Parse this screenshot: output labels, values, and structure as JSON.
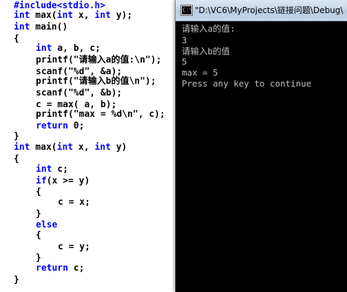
{
  "editor": {
    "lines": [
      {
        "parts": [
          {
            "t": "#include<stdio.h>",
            "k": "pre"
          }
        ]
      },
      {
        "parts": [
          {
            "t": "int",
            "k": "kw"
          },
          {
            "t": " max(",
            "k": "plain"
          },
          {
            "t": "int",
            "k": "kw"
          },
          {
            "t": " x, ",
            "k": "plain"
          },
          {
            "t": "int",
            "k": "kw"
          },
          {
            "t": " y);",
            "k": "plain"
          }
        ]
      },
      {
        "parts": [
          {
            "t": "int",
            "k": "kw"
          },
          {
            "t": " main()",
            "k": "plain"
          }
        ]
      },
      {
        "parts": [
          {
            "t": "{",
            "k": "plain"
          }
        ]
      },
      {
        "parts": [
          {
            "t": "int",
            "k": "kw"
          },
          {
            "t": " a, b, c;",
            "k": "plain"
          }
        ]
      },
      {
        "parts": [
          {
            "t": "printf(\"请输入a的值:\\n\");",
            "k": "plain"
          }
        ]
      },
      {
        "parts": [
          {
            "t": "scanf(\"%d\", &a);",
            "k": "plain"
          }
        ]
      },
      {
        "parts": [
          {
            "t": "printf(\"请输入b的值\\n\");",
            "k": "plain"
          }
        ]
      },
      {
        "parts": [
          {
            "t": "scanf(\"%d\", &b);",
            "k": "plain"
          }
        ]
      },
      {
        "parts": [
          {
            "t": "c = max( a, b);",
            "k": "plain"
          }
        ]
      },
      {
        "parts": [
          {
            "t": "printf(\"max = %d\\n\", c);",
            "k": "plain"
          }
        ]
      },
      {
        "parts": [
          {
            "t": "return",
            "k": "kw"
          },
          {
            "t": " 0;",
            "k": "plain"
          }
        ]
      },
      {
        "parts": [
          {
            "t": "}",
            "k": "plain"
          }
        ]
      },
      {
        "parts": [
          {
            "t": "int",
            "k": "kw"
          },
          {
            "t": " max(",
            "k": "plain"
          },
          {
            "t": "int",
            "k": "kw"
          },
          {
            "t": " x, ",
            "k": "plain"
          },
          {
            "t": "int",
            "k": "kw"
          },
          {
            "t": " y)",
            "k": "plain"
          }
        ]
      },
      {
        "parts": [
          {
            "t": "{",
            "k": "plain"
          }
        ]
      },
      {
        "parts": [
          {
            "t": "int",
            "k": "kw"
          },
          {
            "t": " c;",
            "k": "plain"
          }
        ]
      },
      {
        "parts": [
          {
            "t": "if",
            "k": "kw"
          },
          {
            "t": "(x >= y)",
            "k": "plain"
          }
        ]
      },
      {
        "parts": [
          {
            "t": "{",
            "k": "plain"
          }
        ]
      },
      {
        "parts": [
          {
            "t": "c = x;",
            "k": "plain"
          }
        ]
      },
      {
        "parts": [
          {
            "t": "}",
            "k": "plain"
          }
        ]
      },
      {
        "parts": [
          {
            "t": "else",
            "k": "kw"
          }
        ]
      },
      {
        "parts": [
          {
            "t": "{",
            "k": "plain"
          }
        ]
      },
      {
        "parts": [
          {
            "t": "c = y;",
            "k": "plain"
          }
        ]
      },
      {
        "parts": [
          {
            "t": "}",
            "k": "plain"
          }
        ]
      },
      {
        "parts": [
          {
            "t": "return",
            "k": "kw"
          },
          {
            "t": " c;",
            "k": "plain"
          }
        ]
      },
      {
        "parts": [
          {
            "t": "}",
            "k": "plain"
          }
        ]
      }
    ]
  },
  "console": {
    "title": "\"D:\\VC6\\MyProjects\\链接问题\\Debug\\",
    "icon": "console-app-icon",
    "lines": [
      "请输入a的值:",
      "3",
      "请输入b的值",
      "5",
      "max = 5",
      "Press any key to continue"
    ]
  },
  "colors": {
    "keyword": "#0000ff",
    "code_text": "#000000",
    "console_bg": "#000000",
    "console_text": "#c0c0c0"
  }
}
